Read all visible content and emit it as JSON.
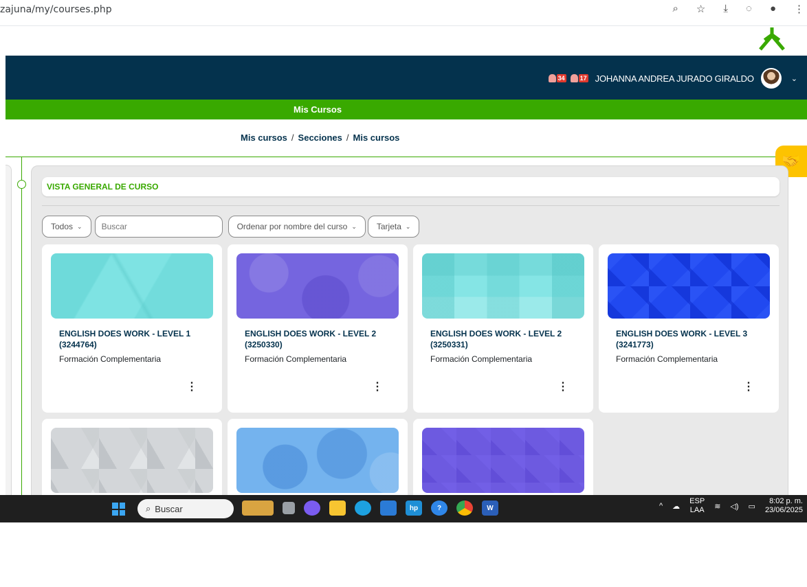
{
  "browser": {
    "url": "zajuna/my/courses.php",
    "icons": [
      "search-icon",
      "star-icon",
      "download-icon",
      "extensions-icon",
      "profile-icon",
      "more-icon"
    ]
  },
  "navbar": {
    "notifications_count": "34",
    "messages_count": "17",
    "user_name": "JOHANNA ANDREA JURADO GIRALDO"
  },
  "header": {
    "title": "Mis Cursos"
  },
  "breadcrumb": {
    "items": [
      "Mis cursos",
      "Secciones",
      "Mis cursos"
    ],
    "separator": "/"
  },
  "overview": {
    "title": "VISTA GENERAL DE CURSO",
    "filter_label": "Todos",
    "search_placeholder": "Buscar",
    "sort_label": "Ordenar por nombre del curso",
    "view_label": "Tarjeta"
  },
  "courses": [
    {
      "title": "ENGLISH DOES WORK - LEVEL 1 (3244764)",
      "category": "Formación Complementaria",
      "pattern": "teal"
    },
    {
      "title": "ENGLISH DOES WORK - LEVEL 2 (3250330)",
      "category": "Formación Complementaria",
      "pattern": "purple"
    },
    {
      "title": "ENGLISH DOES WORK - LEVEL 2 (3250331)",
      "category": "Formación Complementaria",
      "pattern": "tealgrid"
    },
    {
      "title": "ENGLISH DOES WORK - LEVEL 3 (3241773)",
      "category": "Formación Complementaria",
      "pattern": "blue"
    },
    {
      "title": "",
      "category": "",
      "pattern": "gray"
    },
    {
      "title": "",
      "category": "",
      "pattern": "sky"
    },
    {
      "title": "",
      "category": "",
      "pattern": "violet"
    }
  ],
  "taskbar": {
    "search_label": "Buscar",
    "language": "ESP",
    "language_sub": "LAA",
    "time": "8:02 p. m.",
    "date": "23/06/2025"
  },
  "colors": {
    "navy": "#04324d",
    "green": "#39a900",
    "yellow": "#fdc300"
  }
}
